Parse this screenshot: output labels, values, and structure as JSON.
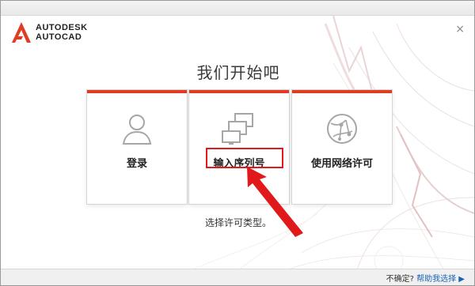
{
  "brand": {
    "line1": "AUTODESK",
    "line2": "AUTOCAD",
    "accent": "#e03c22",
    "logo_icon": "autodesk-a-logo"
  },
  "window": {
    "close_label": "×"
  },
  "title": "我们开始吧",
  "cards": [
    {
      "label": "登录",
      "icon": "user-icon"
    },
    {
      "label": "输入序列号",
      "icon": "monitors-icon"
    },
    {
      "label": "使用网络许可",
      "icon": "network-globe-icon"
    }
  ],
  "hint": "选择许可类型。",
  "footer": {
    "question": "不确定?",
    "link": "帮助我选择",
    "link_arrow": "▶"
  },
  "annotation_color": "#e01a1a"
}
